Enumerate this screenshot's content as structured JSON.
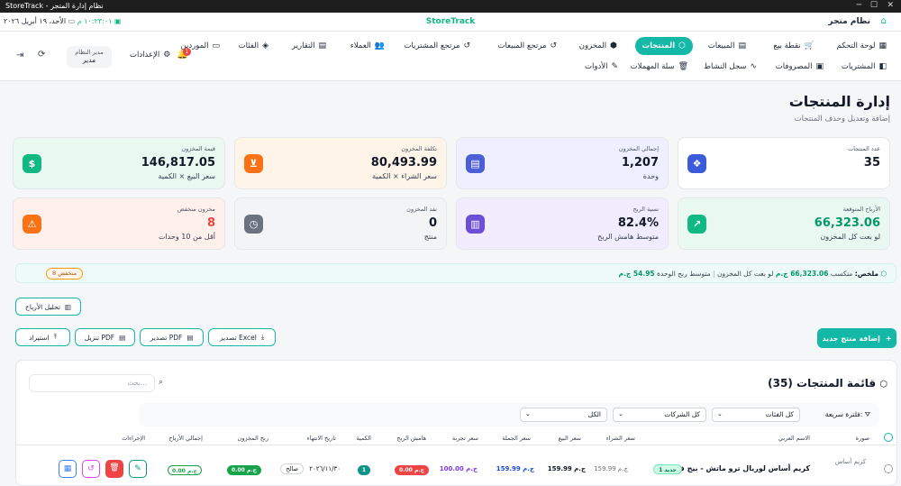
{
  "window": {
    "title": "StoreTrack - نظام إدارة المتجر"
  },
  "appbar": {
    "brand": "StoreTrack",
    "store_name": "نظام متجر",
    "date": "الأحد، ١٩ أبريل ٢٠٢٦",
    "time": "١٠:٢٣:٠١ م"
  },
  "nav": {
    "row1": [
      {
        "label": "لوحة التحكم",
        "icon": "grid-icon"
      },
      {
        "label": "نقطة بيع",
        "icon": "cart-icon"
      },
      {
        "label": "المبيعات",
        "icon": "receipt-icon"
      },
      {
        "label": "المنتجات",
        "icon": "box-icon",
        "active": true
      },
      {
        "label": "المخزون",
        "icon": "warehouse-icon"
      },
      {
        "label": "مرتجع المبيعات",
        "icon": "return-icon"
      },
      {
        "label": "مرتجع المشتريات",
        "icon": "return-icon"
      },
      {
        "label": "العملاء",
        "icon": "users-icon"
      },
      {
        "label": "التقارير",
        "icon": "report-icon"
      },
      {
        "label": "الفئات",
        "icon": "tag-icon"
      },
      {
        "label": "الموردين",
        "icon": "truck-icon"
      }
    ],
    "row2": [
      {
        "label": "المشتريات",
        "icon": "bag-icon"
      },
      {
        "label": "المصروفات",
        "icon": "wallet-icon"
      },
      {
        "label": "سجل النشاط",
        "icon": "activity-icon"
      },
      {
        "label": "سلة المهملات",
        "icon": "trash-icon"
      },
      {
        "label": "الأدوات",
        "icon": "wrench-icon"
      }
    ],
    "settings_label": "الإعدادات",
    "user_role_top": "مدير النظام",
    "user_name": "مدير",
    "notifications_count": "1"
  },
  "page": {
    "title": "إدارة المنتجات",
    "subtitle": "إضافة وتعديل وحذف المنتجات"
  },
  "cards": [
    {
      "label": "عدد المنتجات",
      "value": "35",
      "sub": "",
      "icon": "cubes-icon",
      "color": "#3b5bdb"
    },
    {
      "label": "إجمالي المخزون",
      "value": "1,207",
      "sub": "وحدة",
      "icon": "database-icon",
      "color": "#4c5fd5"
    },
    {
      "label": "تكلفة المخزون",
      "value": "80,493.99",
      "sub": "سعر الشراء × الكمية",
      "icon": "cart-icon",
      "color": "#f97316"
    },
    {
      "label": "قيمة المخزون",
      "value": "146,817.05",
      "sub": "سعر البيع × الكمية",
      "icon": "dollar-icon",
      "color": "#10b981"
    },
    {
      "label": "الأرباح المتوقعة",
      "value": "66,323.06",
      "sub": "لو بعت كل المخزون",
      "icon": "trend-up-icon",
      "color": "#10b981"
    },
    {
      "label": "نسبة الربح",
      "value": "82.4%",
      "sub": "متوسط هامش الربح",
      "icon": "bar-chart-icon",
      "color": "#6d4fd6"
    },
    {
      "label": "نفد المخزون",
      "value": "0",
      "sub": "منتج",
      "icon": "clock-icon",
      "color": "#6b7280"
    },
    {
      "label": "مخزون منخفض",
      "value": "8",
      "sub": "أقل من 10 وحدات",
      "icon": "warning-icon",
      "color": "#f97316"
    }
  ],
  "summary": {
    "label": "ملخص:",
    "text1": "متكسب",
    "profit": "66,323.06 ج.م",
    "text2": "لو بعت كل المخزون",
    "text3": "متوسط ربح الوحدة",
    "avg": "54.95 ج.م",
    "low_badge": "8 منخفض"
  },
  "actions": {
    "profit_analysis": "تحليل الأرباح",
    "add_product": "إضافة منتج جديد",
    "export_excel": "تصدير Excel",
    "export_pdf": "تصدير PDF",
    "download_pdf": "تنزيل PDF",
    "import": "استيراد"
  },
  "list": {
    "title": "قائمة المنتجات (35)",
    "search_placeholder": "بحث...",
    "quick_filter_label": "فلترة سريعة:",
    "filter_categories": "كل الفئات",
    "filter_companies": "كل الشركات",
    "filter_all": "الكل",
    "columns": [
      "صورة",
      "الاسم العربي",
      "سعر الشراء",
      "سعر البيع",
      "سعر الجملة",
      "سعر تجربة",
      "هامش الربح",
      "الكمية",
      "تاريخ الانتهاء",
      "ربح المخزون",
      "إجمالي الأرباح",
      "الإجراءات"
    ],
    "rows": [
      {
        "image_alt": "كريم أساس",
        "name": "كريم أساس لوريال ترو ماتش - بيج فاتح",
        "tag": "جديد 1",
        "buy": "159.99 ج.م",
        "sell": "159.99 ج.م",
        "wholesale": "159.99 ج.م",
        "trial": "100.00 ج.م",
        "margin": "0.00 ج.م",
        "qty": "1",
        "expiry": "٢٠٢٦/١١/٣٠",
        "expiry_status": "صالح",
        "stock_profit": "0.00 ج.م",
        "total_profit": "0.00 ج.م"
      }
    ]
  }
}
